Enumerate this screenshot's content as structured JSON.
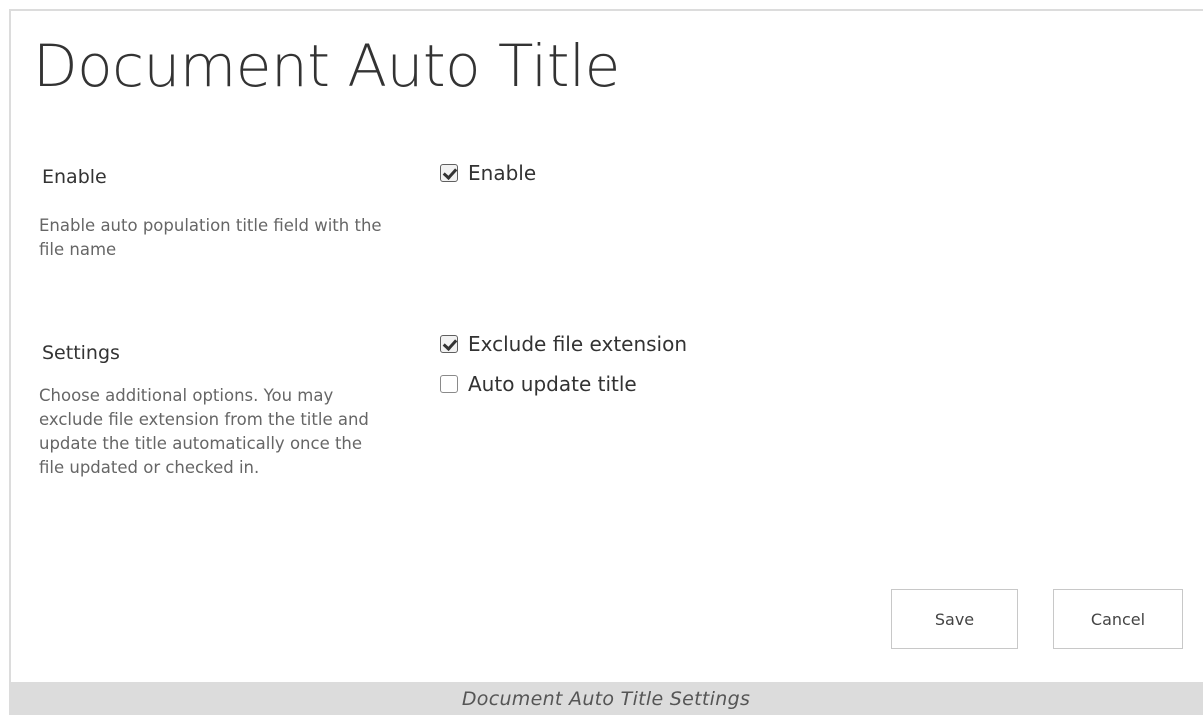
{
  "page": {
    "title": "Document Auto Title"
  },
  "sections": {
    "enable": {
      "title": "Enable",
      "description": "Enable auto population title field with the file name",
      "options": [
        {
          "label": "Enable",
          "checked": true
        }
      ]
    },
    "settings": {
      "title": "Settings",
      "description": "Choose additional options. You may exclude file extension from the title and update the title automatically once the file updated or checked in.",
      "options": [
        {
          "label": "Exclude file extension",
          "checked": true
        },
        {
          "label": "Auto update title",
          "checked": false
        }
      ]
    }
  },
  "buttons": {
    "save": "Save",
    "cancel": "Cancel"
  },
  "caption": "Document Auto Title Settings",
  "icons": {
    "checked": "checkbox-checked-icon",
    "unchecked": "checkbox-unchecked-icon"
  },
  "colors": {
    "title_text": "#333333",
    "description_text": "#666666",
    "caption_bar": "#dcdcdc"
  }
}
